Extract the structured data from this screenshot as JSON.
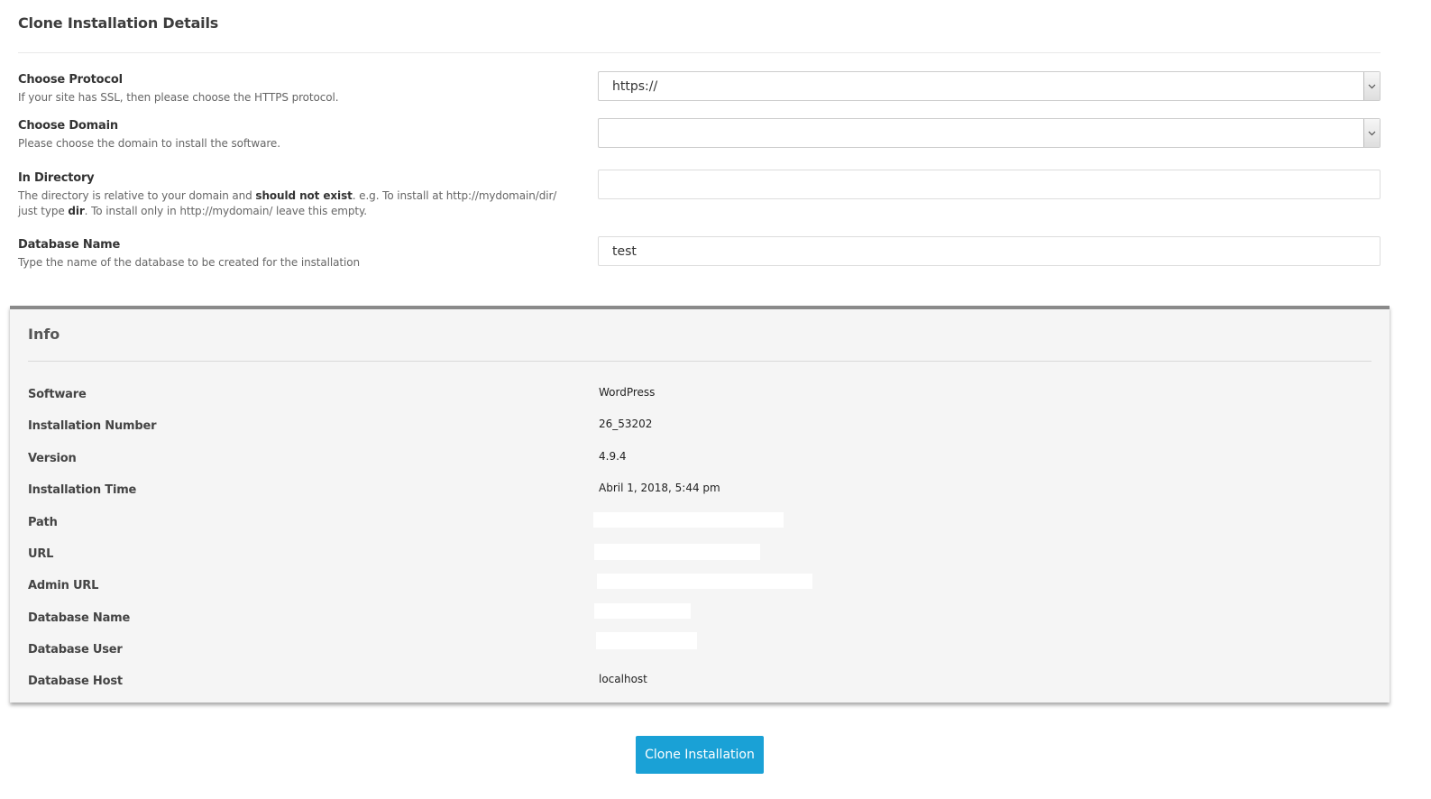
{
  "clone_section": {
    "title": "Clone Installation Details",
    "protocol": {
      "label": "Choose Protocol",
      "help": "If your site has SSL, then please choose the HTTPS protocol.",
      "selected": "https://"
    },
    "domain": {
      "label": "Choose Domain",
      "help": "Please choose the domain to install the software.",
      "selected": ""
    },
    "directory": {
      "label": "In Directory",
      "help_part1": "The directory is relative to your domain and ",
      "help_bold1": "should not exist",
      "help_part2": ". e.g. To install at http://mydomain/dir/ just type ",
      "help_bold2": "dir",
      "help_part3": ". To install only in http://mydomain/ leave this empty.",
      "value": ""
    },
    "database": {
      "label": "Database Name",
      "help": "Type the name of the database to be created for the installation",
      "value": "test"
    }
  },
  "info_section": {
    "title": "Info",
    "rows": [
      {
        "label": "Software",
        "value": "WordPress"
      },
      {
        "label": "Installation Number",
        "value": "26_53202"
      },
      {
        "label": "Version",
        "value": "4.9.4"
      },
      {
        "label": "Installation Time",
        "value": "Abril 1, 2018, 5:44 pm"
      },
      {
        "label": "Path",
        "value": ""
      },
      {
        "label": "URL",
        "value": ""
      },
      {
        "label": "Admin URL",
        "value": ""
      },
      {
        "label": "Database Name",
        "value": ""
      },
      {
        "label": "Database User",
        "value": ""
      },
      {
        "label": "Database Host",
        "value": "localhost"
      }
    ]
  },
  "actions": {
    "clone_label": "Clone Installation"
  },
  "colors": {
    "button_bg": "#1aa1d6",
    "panel_bg": "#f5f5f5",
    "panel_border": "#8a8a8a"
  },
  "icons": {
    "select_arrow": "chevron-down-icon"
  }
}
